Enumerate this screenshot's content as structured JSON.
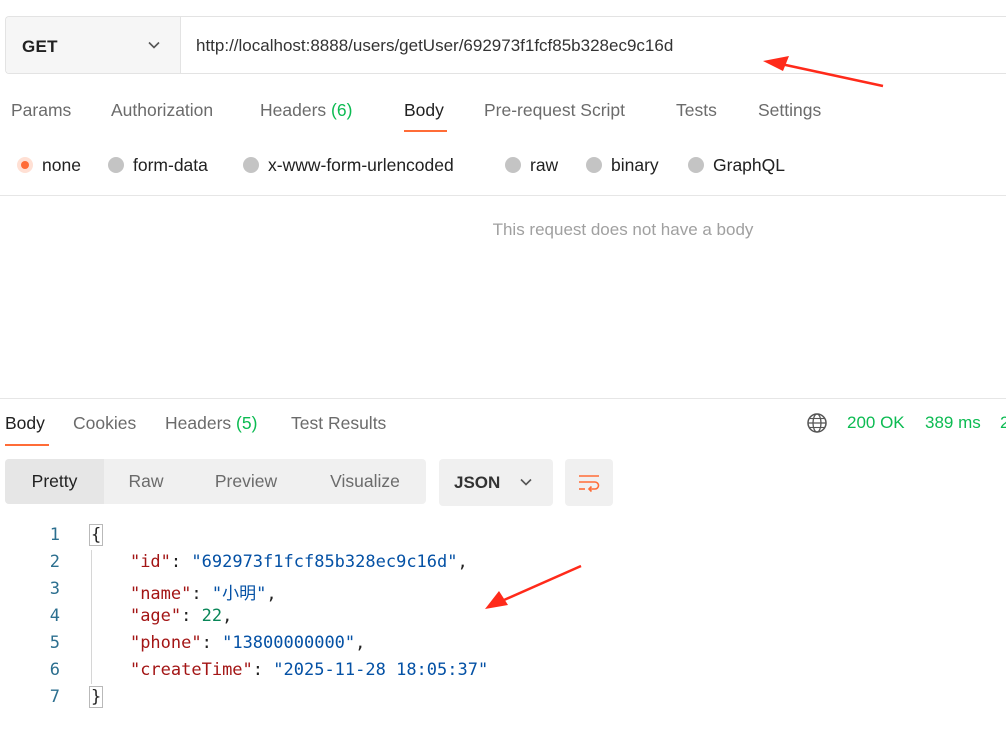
{
  "request": {
    "method": "GET",
    "url": "http://localhost:8888/users/getUser/692973f1fcf85b328ec9c16d"
  },
  "request_tabs": {
    "params": "Params",
    "authorization": "Authorization",
    "headers": "Headers",
    "headers_count": "(6)",
    "body": "Body",
    "pre_request": "Pre-request Script",
    "tests": "Tests",
    "settings": "Settings"
  },
  "body_types": {
    "selected": "none",
    "none": "none",
    "form_data": "form-data",
    "urlencoded": "x-www-form-urlencoded",
    "raw": "raw",
    "binary": "binary",
    "graphql": "GraphQL"
  },
  "empty_body_message": "This request does not have a body",
  "response_tabs": {
    "body": "Body",
    "cookies": "Cookies",
    "headers": "Headers",
    "headers_count": "(5)",
    "test_results": "Test Results"
  },
  "response_meta": {
    "status": "200 OK",
    "time": "389 ms",
    "size_partial": "2"
  },
  "view_modes": {
    "pretty": "Pretty",
    "raw": "Raw",
    "preview": "Preview",
    "visualize": "Visualize",
    "format": "JSON"
  },
  "code": {
    "line_numbers": [
      "1",
      "2",
      "3",
      "4",
      "5",
      "6",
      "7"
    ],
    "open_brace": "{",
    "close_brace": "}",
    "fields": [
      {
        "key": "\"id\"",
        "value": "\"692973f1fcf85b328ec9c16d\"",
        "trail": ","
      },
      {
        "key": "\"name\"",
        "value": "\"小明\"",
        "trail": ","
      },
      {
        "key": "\"age\"",
        "value": "22",
        "trail": ","
      },
      {
        "key": "\"phone\"",
        "value": "\"13800000000\"",
        "trail": ","
      },
      {
        "key": "\"createTime\"",
        "value": "\"2025-11-28 18:05:37\"",
        "trail": ""
      }
    ]
  },
  "colors": {
    "accent": "#ff6c37",
    "success": "#0cbb52",
    "annotation_arrow": "#ff2a1a"
  }
}
